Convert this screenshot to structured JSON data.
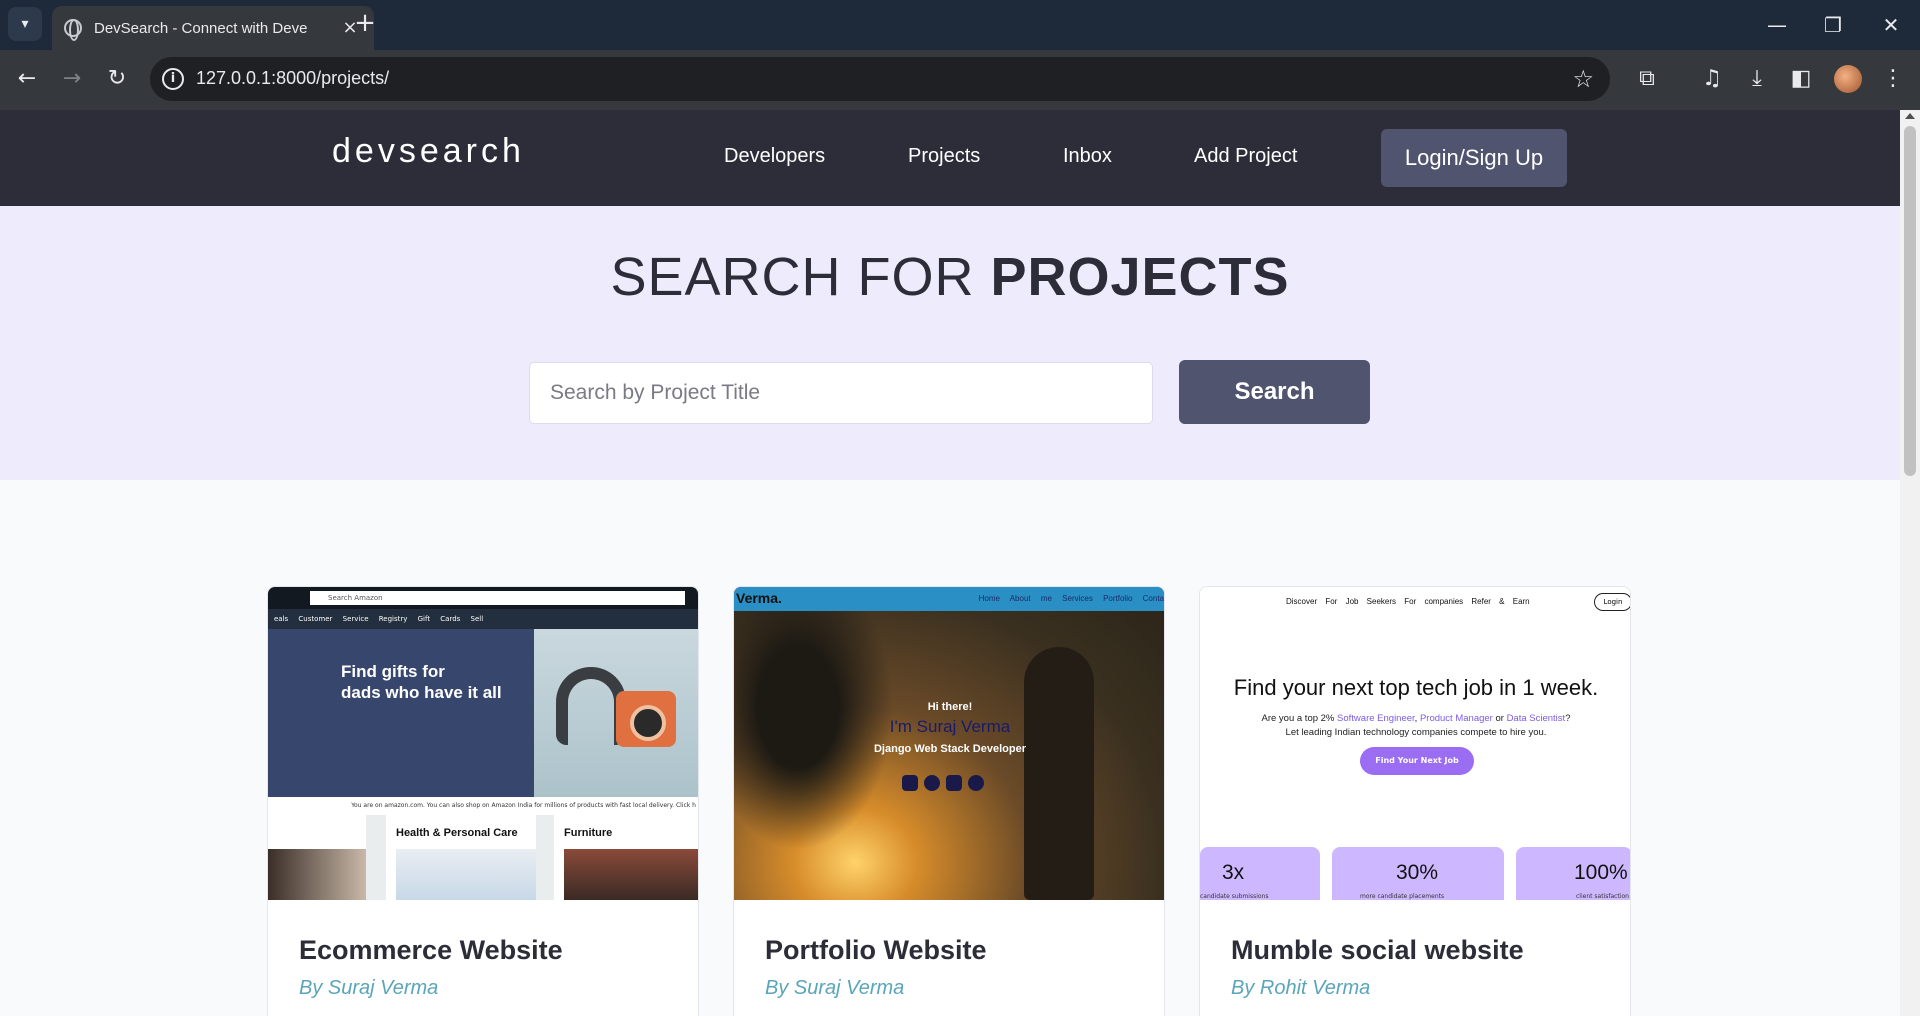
{
  "browser": {
    "tab_title": "DevSearch - Connect with Deve",
    "url": "127.0.0.1:8000/projects/"
  },
  "header": {
    "logo": "devsearch",
    "nav": [
      "Developers",
      "Projects",
      "Inbox",
      "Add Project"
    ],
    "login_label": "Login/Sign Up"
  },
  "hero": {
    "title_light": "SEARCH FOR ",
    "title_bold": "PROJECTS",
    "search_placeholder": "Search by Project Title",
    "search_button": "Search"
  },
  "projects": [
    {
      "title": "Ecommerce Website",
      "author": "By Suraj Verma",
      "thumb": {
        "search_placeholder": "Search Amazon",
        "subnav": "eals Customer Service Registry Gift Cards Sell",
        "banner_line1": "Find gifts for",
        "banner_line2": "dads who have it all",
        "note": "You are on amazon.com. You can also shop on Amazon India for millions of products with fast local delivery. Click h",
        "tiles": [
          "Health & Personal Care",
          "Furniture"
        ]
      }
    },
    {
      "title": "Portfolio Website",
      "author": "By Suraj Verma",
      "thumb": {
        "brand": "Verma.",
        "links": "Home About me Services Portfolio Conta",
        "greeting": "Hi there!",
        "name": "I'm Suraj Verma",
        "role": "Django Web Stack Developer"
      }
    },
    {
      "title": "Mumble social website",
      "author": "By Rohit Verma",
      "thumb": {
        "nav": "Discover For Job Seekers For companies Refer & Earn",
        "login": "Login",
        "heading": "Find your next top tech job in 1 week.",
        "line1_prefix": "Are you a top 2% ",
        "role1": "Software Engineer",
        "sep1": ", ",
        "role2": "Product Manager",
        "sep2": " or ",
        "role3": "Data Scientist",
        "line1_suffix": "?",
        "line2": "Let leading Indian technology companies compete to hire you.",
        "cta": "Find Your Next Job",
        "stats": [
          {
            "value": "3x",
            "sub": "candidate submissions"
          },
          {
            "value": "30%",
            "sub": "more candidate placements"
          },
          {
            "value": "100%",
            "sub": "client satisfaction"
          }
        ]
      }
    }
  ]
}
